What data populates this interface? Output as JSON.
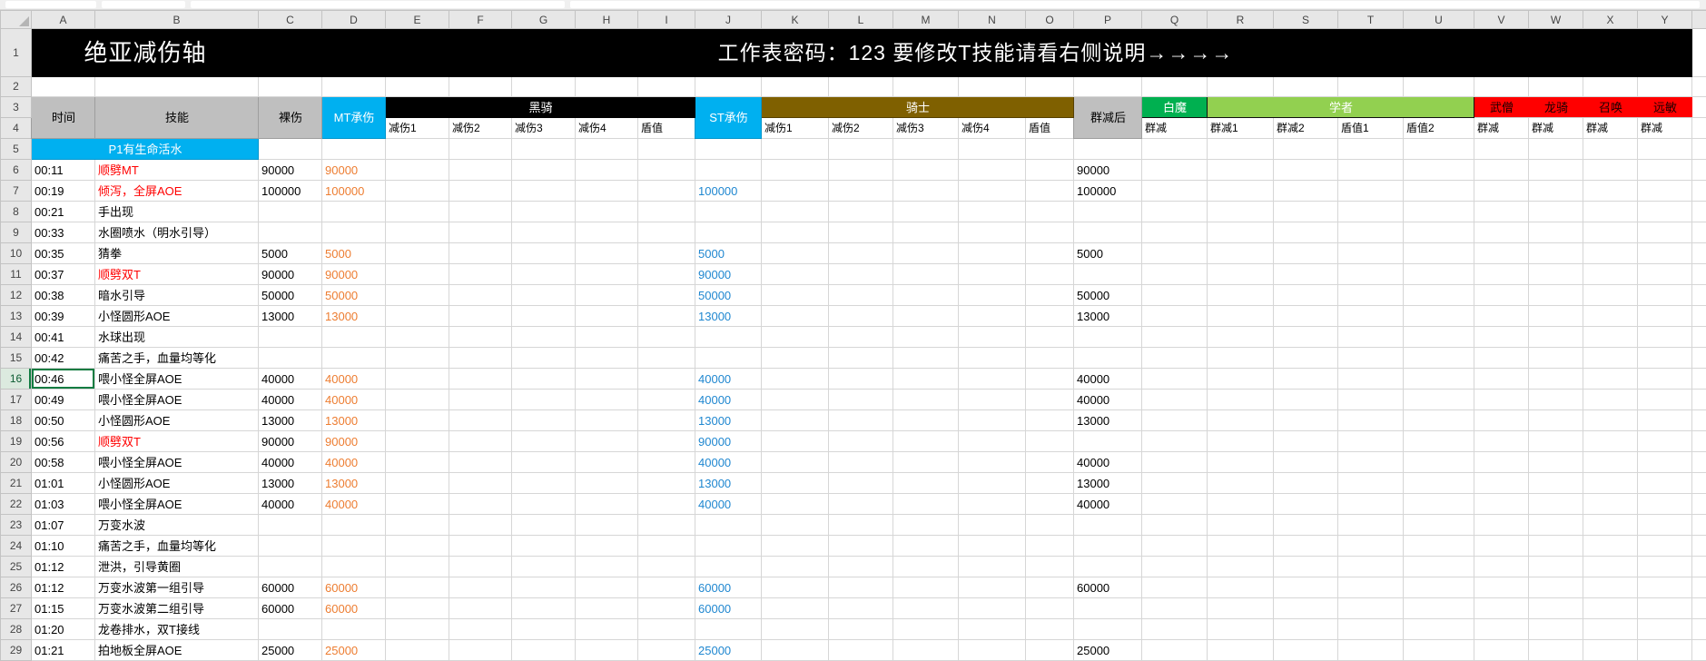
{
  "titles": {
    "left": "绝亚减伤轴",
    "right": "工作表密码：123 要修改T技能请看右侧说明→→→→"
  },
  "column_letters": [
    "A",
    "B",
    "C",
    "D",
    "E",
    "F",
    "G",
    "H",
    "I",
    "J",
    "K",
    "L",
    "M",
    "N",
    "O",
    "P",
    "Q",
    "R",
    "S",
    "T",
    "U",
    "V",
    "W",
    "X",
    "Y"
  ],
  "row_numbers_static": [
    "1",
    "2",
    "3",
    "4"
  ],
  "headers": {
    "time": "时间",
    "skill": "技能",
    "raw": "裸伤",
    "mt": "MT承伤",
    "st": "ST承伤",
    "post": "群减后",
    "groups": {
      "dark_knight": {
        "label": "黑骑",
        "subs": [
          "减伤1",
          "减伤2",
          "减伤3",
          "减伤4",
          "盾值"
        ]
      },
      "paladin": {
        "label": "骑士",
        "subs": [
          "减伤1",
          "减伤2",
          "减伤3",
          "减伤4",
          "盾值"
        ]
      },
      "white_mage": {
        "label": "白魔",
        "subs": [
          "群减"
        ]
      },
      "scholar": {
        "label": "学者",
        "subs": [
          "群减1",
          "群减2",
          "盾值1",
          "盾值2"
        ]
      },
      "monk": {
        "label": "武僧",
        "subs": [
          "群减"
        ]
      },
      "dragoon": {
        "label": "龙骑",
        "subs": [
          "群减"
        ]
      },
      "summoner": {
        "label": "召唤",
        "subs": [
          "群减"
        ]
      },
      "ranged": {
        "label": "远敏",
        "subs": [
          "群减"
        ]
      }
    }
  },
  "section": {
    "n": "5",
    "label": "P1有生命活水"
  },
  "active_cell_row": "16",
  "rows": [
    {
      "n": "6",
      "time": "00:11",
      "skill": "顺劈MT",
      "red": true,
      "raw": "90000",
      "mt": "90000",
      "st": "",
      "post": "90000"
    },
    {
      "n": "7",
      "time": "00:19",
      "skill": "倾泻，全屏AOE",
      "red": true,
      "raw": "100000",
      "mt": "100000",
      "st": "100000",
      "post": "100000"
    },
    {
      "n": "8",
      "time": "00:21",
      "skill": "手出现",
      "red": false,
      "raw": "",
      "mt": "",
      "st": "",
      "post": ""
    },
    {
      "n": "9",
      "time": "00:33",
      "skill": "水圈喷水（明水引导）",
      "red": false,
      "raw": "",
      "mt": "",
      "st": "",
      "post": ""
    },
    {
      "n": "10",
      "time": "00:35",
      "skill": "猜拳",
      "red": false,
      "raw": "5000",
      "mt": "5000",
      "st": "5000",
      "post": "5000"
    },
    {
      "n": "11",
      "time": "00:37",
      "skill": "顺劈双T",
      "red": true,
      "raw": "90000",
      "mt": "90000",
      "st": "90000",
      "post": ""
    },
    {
      "n": "12",
      "time": "00:38",
      "skill": "暗水引导",
      "red": false,
      "raw": "50000",
      "mt": "50000",
      "st": "50000",
      "post": "50000"
    },
    {
      "n": "13",
      "time": "00:39",
      "skill": "小怪圆形AOE",
      "red": false,
      "raw": "13000",
      "mt": "13000",
      "st": "13000",
      "post": "13000"
    },
    {
      "n": "14",
      "time": "00:41",
      "skill": "水球出现",
      "red": false,
      "raw": "",
      "mt": "",
      "st": "",
      "post": ""
    },
    {
      "n": "15",
      "time": "00:42",
      "skill": "痛苦之手，血量均等化",
      "red": false,
      "raw": "",
      "mt": "",
      "st": "",
      "post": ""
    },
    {
      "n": "16",
      "time": "00:46",
      "skill": "喂小怪全屏AOE",
      "red": false,
      "raw": "40000",
      "mt": "40000",
      "st": "40000",
      "post": "40000"
    },
    {
      "n": "17",
      "time": "00:49",
      "skill": "喂小怪全屏AOE",
      "red": false,
      "raw": "40000",
      "mt": "40000",
      "st": "40000",
      "post": "40000"
    },
    {
      "n": "18",
      "time": "00:50",
      "skill": "小怪圆形AOE",
      "red": false,
      "raw": "13000",
      "mt": "13000",
      "st": "13000",
      "post": "13000"
    },
    {
      "n": "19",
      "time": "00:56",
      "skill": "顺劈双T",
      "red": true,
      "raw": "90000",
      "mt": "90000",
      "st": "90000",
      "post": ""
    },
    {
      "n": "20",
      "time": "00:58",
      "skill": "喂小怪全屏AOE",
      "red": false,
      "raw": "40000",
      "mt": "40000",
      "st": "40000",
      "post": "40000"
    },
    {
      "n": "21",
      "time": "01:01",
      "skill": "小怪圆形AOE",
      "red": false,
      "raw": "13000",
      "mt": "13000",
      "st": "13000",
      "post": "13000"
    },
    {
      "n": "22",
      "time": "01:03",
      "skill": "喂小怪全屏AOE",
      "red": false,
      "raw": "40000",
      "mt": "40000",
      "st": "40000",
      "post": "40000"
    },
    {
      "n": "23",
      "time": "01:07",
      "skill": "万变水波",
      "red": false,
      "raw": "",
      "mt": "",
      "st": "",
      "post": ""
    },
    {
      "n": "24",
      "time": "01:10",
      "skill": "痛苦之手，血量均等化",
      "red": false,
      "raw": "",
      "mt": "",
      "st": "",
      "post": ""
    },
    {
      "n": "25",
      "time": "01:12",
      "skill": "泄洪，引导黄圈",
      "red": false,
      "raw": "",
      "mt": "",
      "st": "",
      "post": ""
    },
    {
      "n": "26",
      "time": "01:12",
      "skill": "万变水波第一组引导",
      "red": false,
      "raw": "60000",
      "mt": "60000",
      "st": "60000",
      "post": "60000"
    },
    {
      "n": "27",
      "time": "01:15",
      "skill": "万变水波第二组引导",
      "red": false,
      "raw": "60000",
      "mt": "60000",
      "st": "60000",
      "post": ""
    },
    {
      "n": "28",
      "time": "01:20",
      "skill": "龙卷排水，双T接线",
      "red": false,
      "raw": "",
      "mt": "",
      "st": "",
      "post": ""
    },
    {
      "n": "29",
      "time": "01:21",
      "skill": "拍地板全屏AOE",
      "red": false,
      "raw": "25000",
      "mt": "25000",
      "st": "25000",
      "post": "25000"
    }
  ],
  "colors": {
    "accent_cyan": "#00B0F0",
    "dark_knight_black": "#000000",
    "paladin_olive": "#7F6000",
    "white_mage_green": "#00B050",
    "scholar_light_green": "#92D050",
    "dps_red": "#FF0000",
    "header_gray": "#BFBFBF",
    "mt_value_orange": "#ED7D31",
    "st_value_blue": "#1F87D0",
    "skill_alert_red": "#FF0000",
    "active_cell_green": "#107C41"
  }
}
